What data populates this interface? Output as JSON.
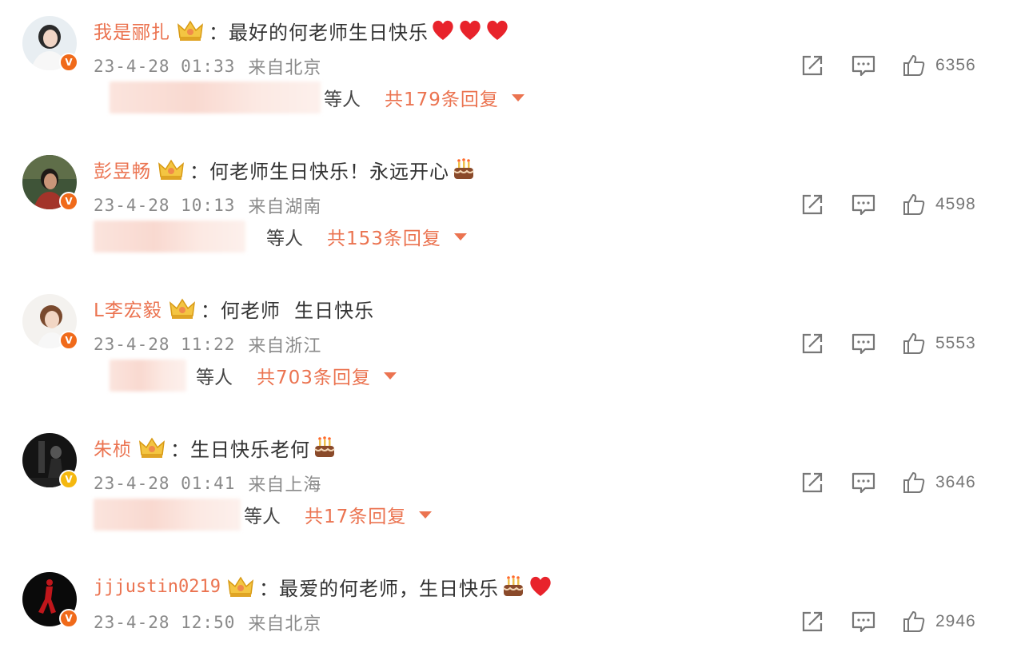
{
  "comments": [
    {
      "username": "我是郦扎",
      "text": "：最好的何老师生日快乐",
      "emojis": [
        "heart",
        "heart",
        "heart"
      ],
      "timestamp": "23-4-28 01:33",
      "location": "来自北京",
      "likes": "6356",
      "reply_etc": "等人",
      "reply_total": "共179条回复",
      "badge": "red"
    },
    {
      "username": "彭昱畅",
      "text": "：何老师生日快乐！永远开心",
      "emojis": [
        "cake"
      ],
      "timestamp": "23-4-28 10:13",
      "location": "来自湖南",
      "likes": "4598",
      "reply_etc": "等人",
      "reply_total": "共153条回复",
      "badge": "red"
    },
    {
      "username": "L李宏毅",
      "text": "：何老师  生日快乐",
      "emojis": [],
      "timestamp": "23-4-28 11:22",
      "location": "来自浙江",
      "likes": "5553",
      "reply_etc": "等人",
      "reply_total": "共703条回复",
      "badge": "red"
    },
    {
      "username": "朱桢",
      "text": "：生日快乐老何",
      "emojis": [
        "cake"
      ],
      "timestamp": "23-4-28 01:41",
      "location": "来自上海",
      "likes": "3646",
      "reply_etc": "等人",
      "reply_total": "共17条回复",
      "badge": "gold"
    },
    {
      "username": "jjjustin0219",
      "text": "：最爱的何老师，生日快乐",
      "emojis": [
        "cake",
        "heart"
      ],
      "timestamp": "23-4-28 12:50",
      "location": "来自北京",
      "likes": "2946",
      "reply_etc": "",
      "reply_total": "",
      "badge": "red"
    }
  ],
  "badge_letter": "V",
  "icons": {
    "share": "share-icon",
    "comment": "comment-icon",
    "like": "like-icon",
    "crown": "crown-icon"
  },
  "colors": {
    "username": "#eb7350",
    "badge_red": "#f06a1a",
    "badge_gold": "#f5b80f",
    "heart": "#e8232b"
  }
}
